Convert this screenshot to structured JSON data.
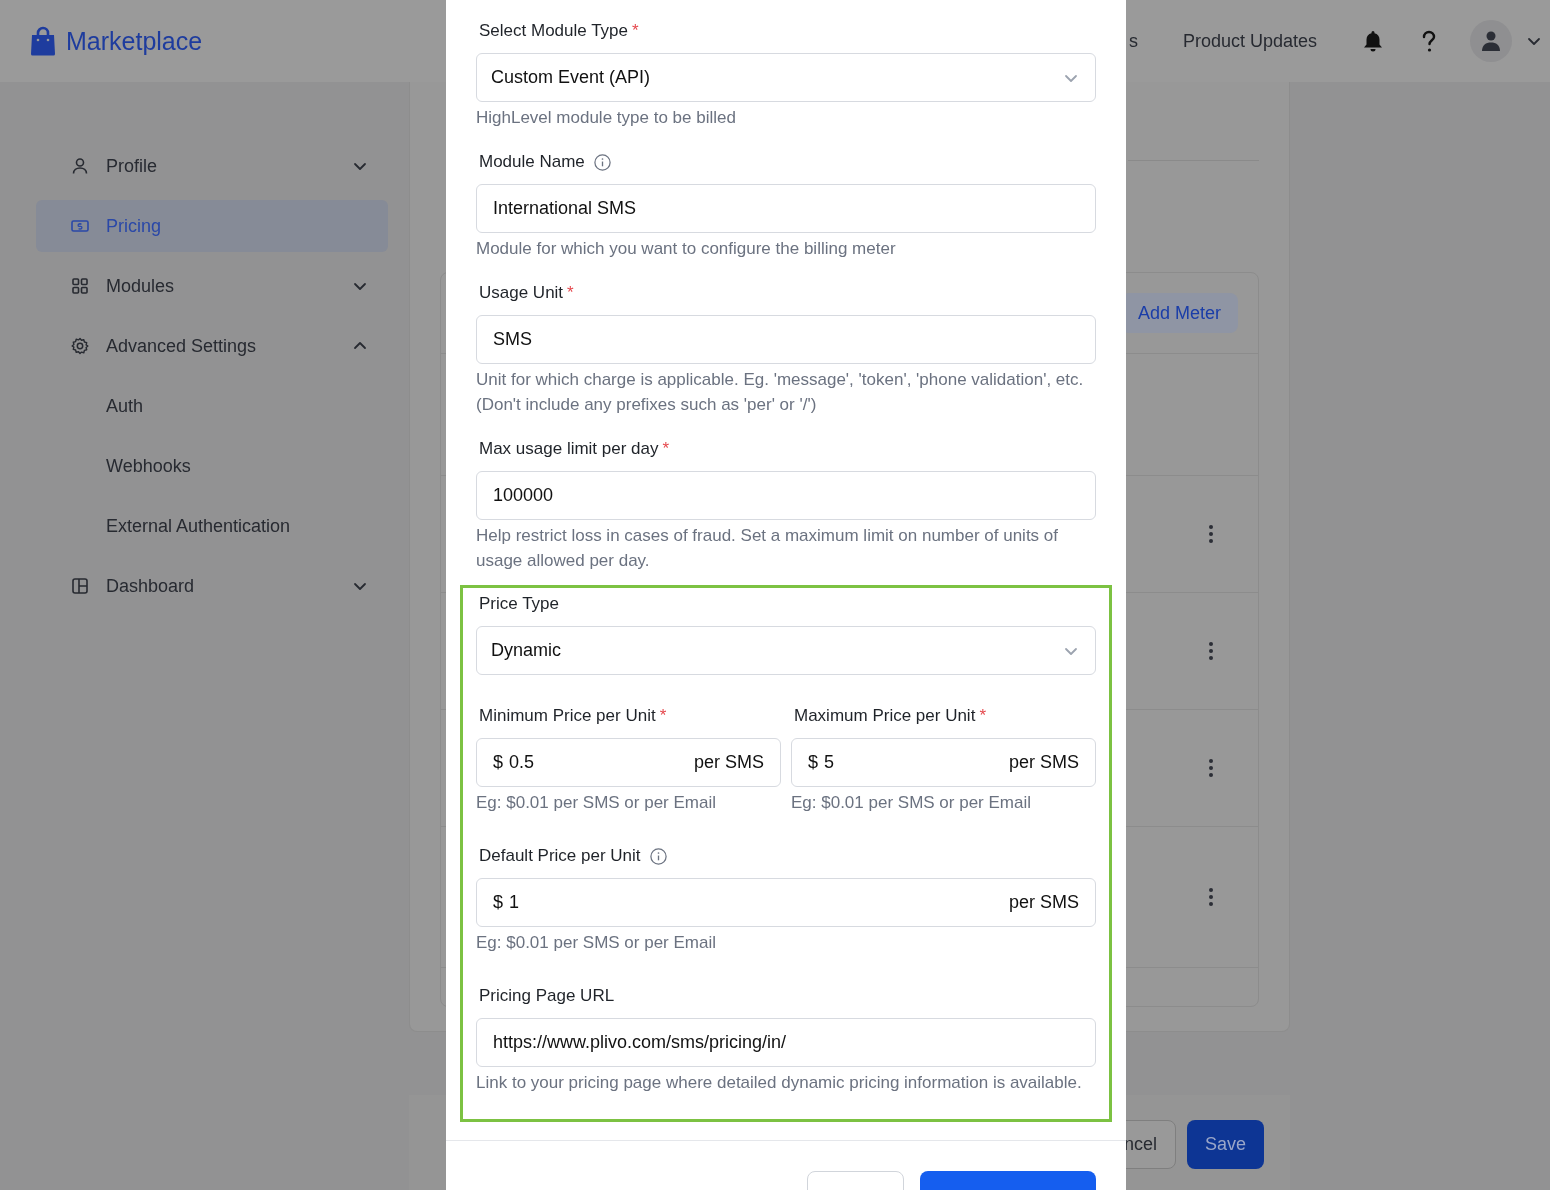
{
  "header": {
    "brand": "Marketplace",
    "nav": [
      "s",
      "Product Updates"
    ]
  },
  "sidebar": {
    "items": [
      {
        "label": "Profile",
        "kind": "group",
        "selected": false,
        "expanded": false
      },
      {
        "label": "Pricing",
        "kind": "link",
        "selected": true
      },
      {
        "label": "Modules",
        "kind": "group",
        "selected": false,
        "expanded": false
      },
      {
        "label": "Advanced Settings",
        "kind": "group",
        "selected": false,
        "expanded": true,
        "children": [
          {
            "label": "Auth",
            "selected": false
          },
          {
            "label": "Webhooks",
            "selected": false
          },
          {
            "label": "External Authentication",
            "selected": false
          }
        ]
      },
      {
        "label": "Dashboard",
        "kind": "group",
        "selected": false,
        "expanded": false
      }
    ]
  },
  "main": {
    "add_button": "Add Meter",
    "footer_buttons": [
      {
        "label": "ncel",
        "kind": "secondary"
      },
      {
        "label": "Save",
        "kind": "primary"
      }
    ]
  },
  "modal": {
    "fields": [
      {
        "kind": "select",
        "label": "Select Module Type",
        "marker": "*",
        "info": false,
        "value": "Custom Event (API)",
        "help": "HighLevel module type to be billed"
      },
      {
        "kind": "input",
        "label": "Module Name",
        "info": true,
        "value": "International SMS",
        "help": "Module for which you want to configure the billing meter"
      },
      {
        "kind": "input",
        "label": "Usage Unit",
        "marker": "*",
        "info": false,
        "value": "SMS",
        "help": "Unit for which charge is applicable. Eg. 'message', 'token', 'phone validation', etc. (Don't include any prefixes such as 'per' or '/')"
      },
      {
        "kind": "input",
        "label": "Max usage limit per day",
        "marker": "*",
        "info": false,
        "value": "100000",
        "help": "Help restrict loss in cases of fraud. Set a maximum limit on number of units of usage allowed per day."
      }
    ],
    "price_section": {
      "highlighted": true,
      "price_type": {
        "label": "Price Type",
        "value": "Dynamic"
      },
      "range": [
        {
          "label": "Minimum Price per Unit",
          "marker": "*",
          "prefix": "$",
          "value": "0.5",
          "suffix": "per SMS",
          "help": "Eg: $0.01 per SMS or per Email"
        },
        {
          "label": "Maximum Price per Unit",
          "marker": "*",
          "prefix": "$",
          "value": "5",
          "suffix": "per SMS",
          "help": "Eg: $0.01 per SMS or per Email"
        }
      ],
      "default": {
        "label": "Default Price per Unit",
        "info": true,
        "prefix": "$",
        "value": "1",
        "suffix": "per SMS",
        "help": "Eg: $0.01 per SMS or per Email"
      },
      "url": {
        "label": "Pricing Page URL",
        "value": "https://www.plivo.com/sms/pricing/in/",
        "help": "Link to your pricing page where detailed dynamic pricing information is available."
      }
    },
    "footer_buttons": [
      {
        "kind": "secondary"
      },
      {
        "kind": "primary"
      }
    ]
  }
}
